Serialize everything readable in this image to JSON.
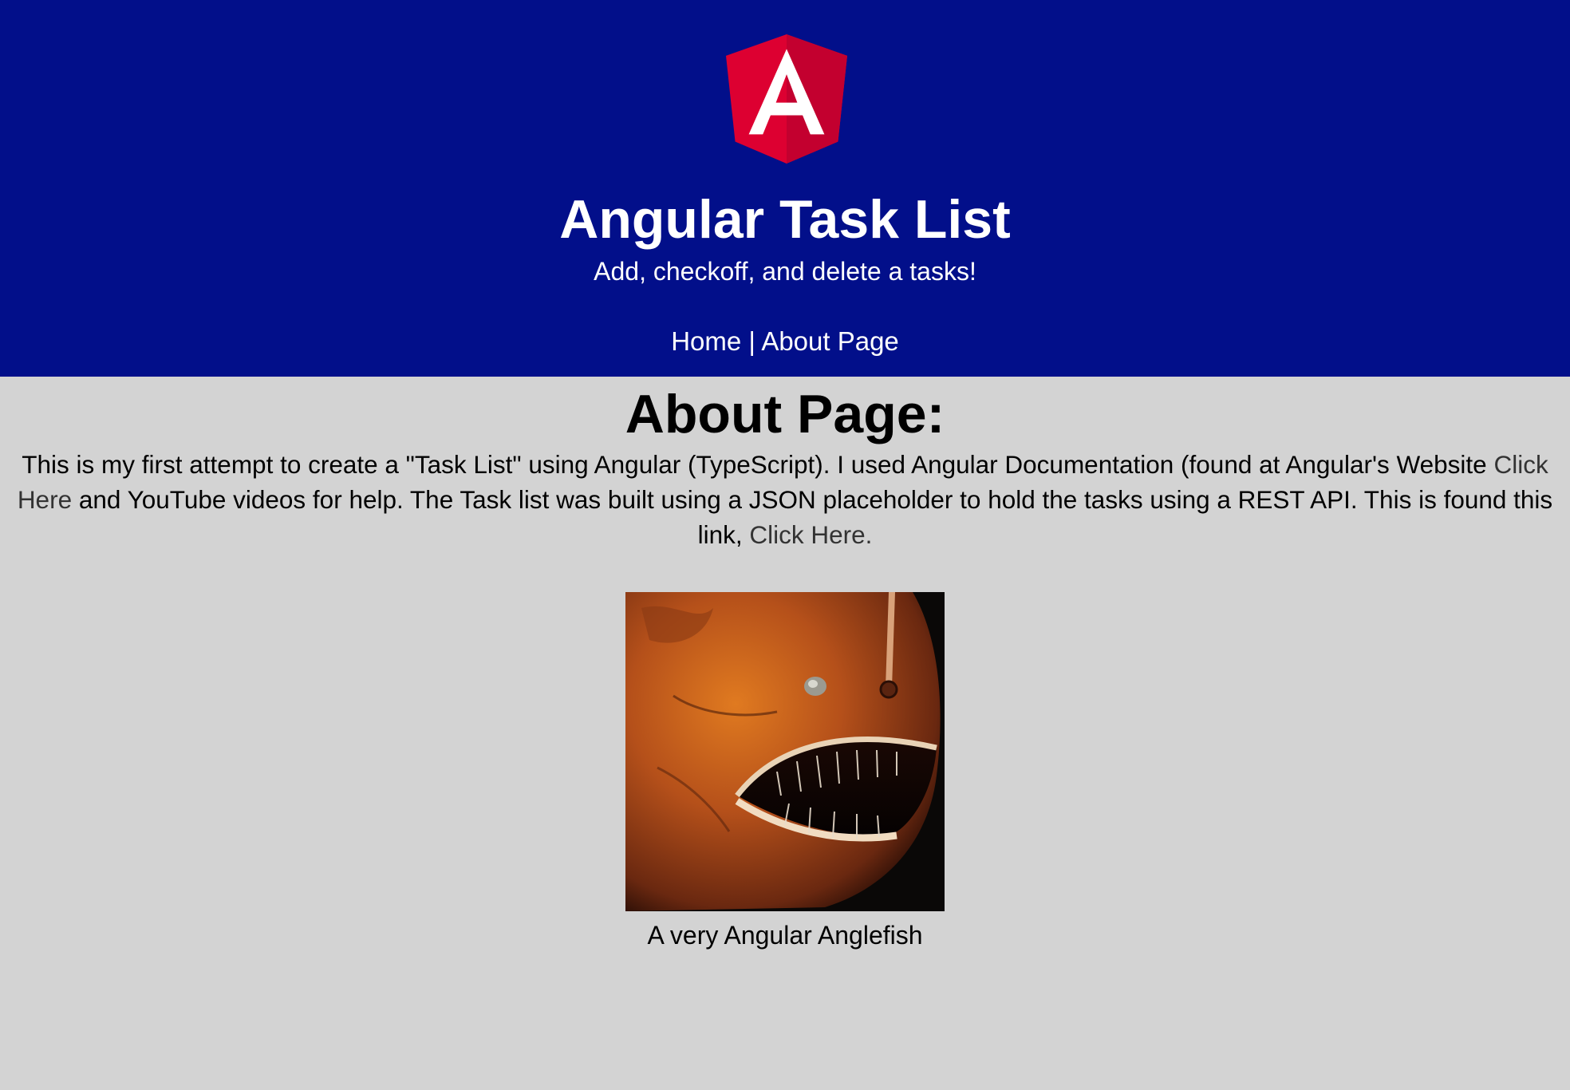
{
  "header": {
    "logo_letter": "A",
    "title": "Angular Task List",
    "subtitle": "Add, checkoff, and delete a tasks!",
    "nav": {
      "home_label": "Home",
      "separator": " | ",
      "about_label": "About Page"
    }
  },
  "main": {
    "page_title": "About Page:",
    "intro": {
      "part1": "This is my first attempt to create a \"Task List\" using Angular (TypeScript). I used Angular Documentation (found at Angular's Website ",
      "link1": "Click Here",
      "part2": " and YouTube videos for help. The Task list was built using a JSON placeholder to hold the tasks using a REST API. This is found this link, ",
      "link2": "Click Here."
    },
    "figure": {
      "image_name": "anglerfish-photo",
      "caption": "A very Angular Anglefish"
    }
  },
  "colors": {
    "header_bg": "#020f8a",
    "page_bg": "#d3d3d3",
    "logo_red": "#dd0031",
    "logo_dark_red": "#c3002f",
    "link_color": "#333333"
  }
}
